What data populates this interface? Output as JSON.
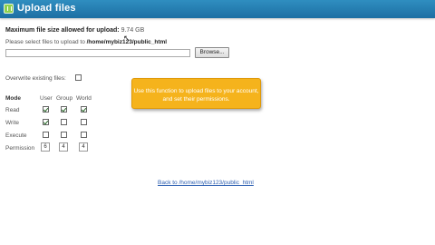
{
  "header": {
    "title": "Upload files"
  },
  "upload": {
    "max_size_label": "Maximum file size allowed for upload:",
    "max_size_value": "9.74 GB",
    "select_label": "Please select files to upload to",
    "select_path": "/home/mybiz123/public_html",
    "file_value": "",
    "browse_label": "Browse..."
  },
  "overwrite": {
    "label": "Overwrite existing files:",
    "checked": false
  },
  "permissions": {
    "headers": {
      "mode": "Mode",
      "user": "User",
      "group": "Group",
      "world": "World"
    },
    "rows": [
      {
        "label": "Read",
        "user": true,
        "group": true,
        "world": true
      },
      {
        "label": "Write",
        "user": true,
        "group": false,
        "world": false
      },
      {
        "label": "Execute",
        "user": false,
        "group": false,
        "world": false
      }
    ],
    "permission_label": "Permission",
    "values": {
      "user": "6",
      "group": "4",
      "world": "4"
    }
  },
  "callout": {
    "text": "Use this function to upload files to your account, and set their permissions."
  },
  "footer": {
    "back_link": "Back to /home/mybiz123/public_html"
  },
  "colors": {
    "titlebar": "#1d6fa3",
    "callout": "#f5b31c",
    "link": "#2a5db0"
  }
}
